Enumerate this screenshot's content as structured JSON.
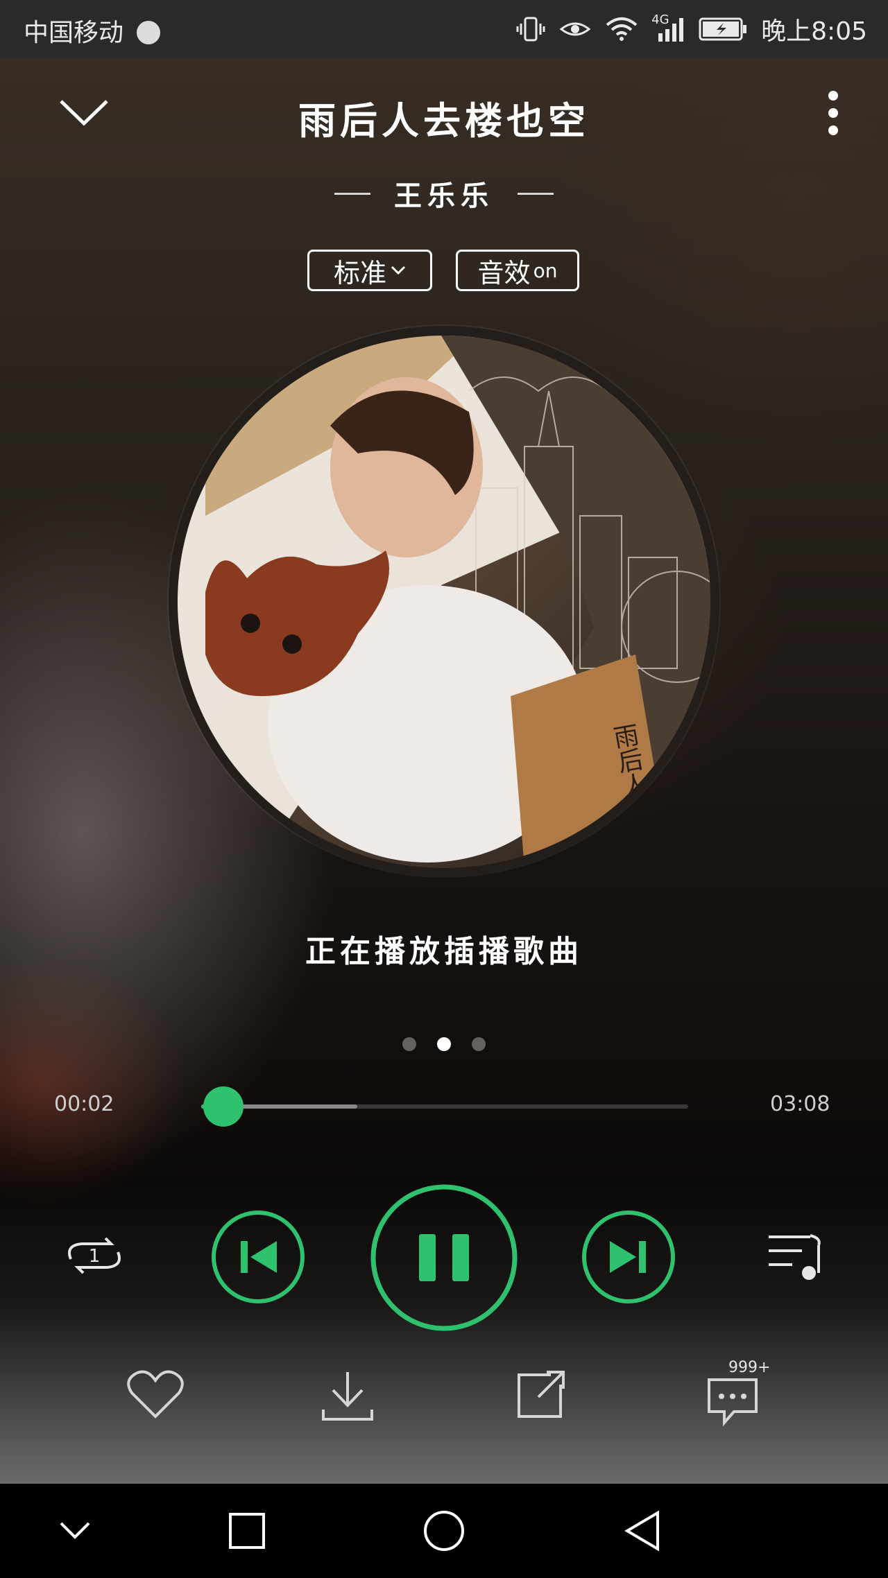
{
  "status_bar": {
    "carrier": "中国移动",
    "network": "4G",
    "time": "晚上8:05"
  },
  "song": {
    "title": "雨后人去楼也空",
    "artist": "王乐乐",
    "cover_text": "雨后人楼也空。"
  },
  "quality": {
    "label": "标准",
    "effect_label": "音效",
    "effect_state": "on"
  },
  "lyric": "正在播放插播歌曲",
  "pager": {
    "count": 3,
    "active_index": 1
  },
  "progress": {
    "current": "00:02",
    "total": "03:08",
    "played_fraction": 0.011,
    "buffered_fraction": 0.32
  },
  "controls": {
    "repeat_mode": "1",
    "icons": [
      "repeat-one-icon",
      "previous-icon",
      "pause-icon",
      "next-icon",
      "playlist-icon"
    ],
    "accent_color": "#2fc26e"
  },
  "actions": {
    "comment_count": "999+",
    "icons": [
      "heart-icon",
      "download-icon",
      "share-icon",
      "comment-icon"
    ]
  },
  "navigation": {
    "icons": [
      "nav-down-icon",
      "nav-recent-icon",
      "nav-home-icon",
      "nav-back-icon"
    ]
  }
}
